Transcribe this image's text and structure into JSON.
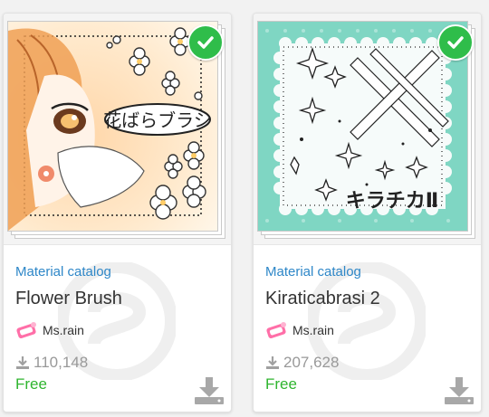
{
  "cards": [
    {
      "category": "Material catalog",
      "title": "Flower Brush",
      "author": "Ms.rain",
      "downloads": "110,148",
      "price": "Free",
      "thumb_text": "花ばらブラシ",
      "selected": true
    },
    {
      "category": "Material catalog",
      "title": "Kiraticabrasi 2",
      "author": "Ms.rain",
      "downloads": "207,628",
      "price": "Free",
      "thumb_text": "キラチカⅡ",
      "selected": true
    }
  ],
  "colors": {
    "category_link": "#2e87c8",
    "price_free": "#2fb52f",
    "check_badge": "#2fbd4a",
    "icon_gray": "#a0a0a0",
    "teal_background": "#7fd6c3"
  },
  "icons": {
    "selected": "check-icon",
    "downloads": "download-count-icon",
    "download_action": "download-icon",
    "author": "author-avatar"
  }
}
